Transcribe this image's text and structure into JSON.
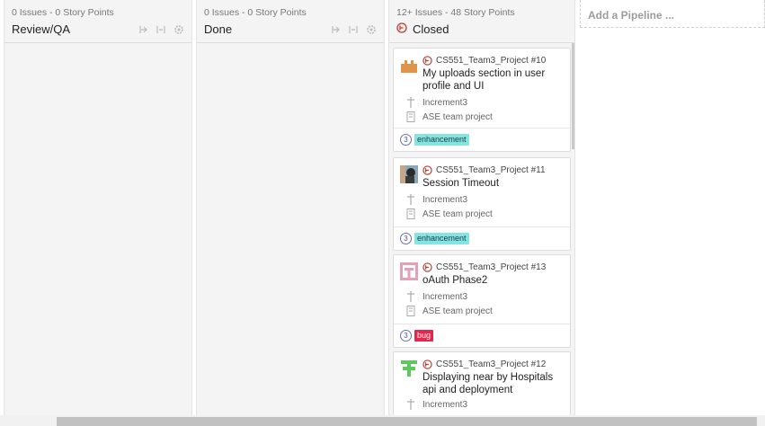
{
  "pipelines": [
    {
      "meta": "0 Issues - 0 Story Points",
      "title": "Review/QA"
    },
    {
      "meta": "0 Issues - 0 Story Points",
      "title": "Done"
    },
    {
      "meta": "12+ Issues - 48 Story Points",
      "title": "Closed"
    }
  ],
  "add_pipeline": "Add a Pipeline ...",
  "cards": [
    {
      "issue": "CS551_Team3_Project #10",
      "title": "My uploads section in user profile and UI",
      "milestone": "Increment3",
      "epic": "ASE team project",
      "points": "3",
      "label": "enhancement",
      "label_type": "enh",
      "avatar_icon": "castle-identicon-icon"
    },
    {
      "issue": "CS551_Team3_Project #11",
      "title": "Session Timeout",
      "milestone": "Increment3",
      "epic": "ASE team project",
      "points": "3",
      "label": "enhancement",
      "label_type": "enh",
      "avatar_icon": "photo-avatar-icon"
    },
    {
      "issue": "CS551_Team3_Project #13",
      "title": "oAuth Phase2",
      "milestone": "Increment3",
      "epic": "ASE team project",
      "points": "3",
      "label": "bug",
      "label_type": "bug",
      "avatar_icon": "pink-identicon-icon"
    },
    {
      "issue": "CS551_Team3_Project #12",
      "title": "Displaying near by Hospitals api and deployment",
      "milestone": "Increment3",
      "epic": "",
      "points": "",
      "label": "",
      "label_type": "",
      "avatar_icon": "green-identicon-icon"
    }
  ],
  "colors": {
    "closed_icon": "#c0392b",
    "enhancement": "#84e3e3",
    "bug": "#e3284c",
    "points_ring": "#6a6fb0"
  }
}
